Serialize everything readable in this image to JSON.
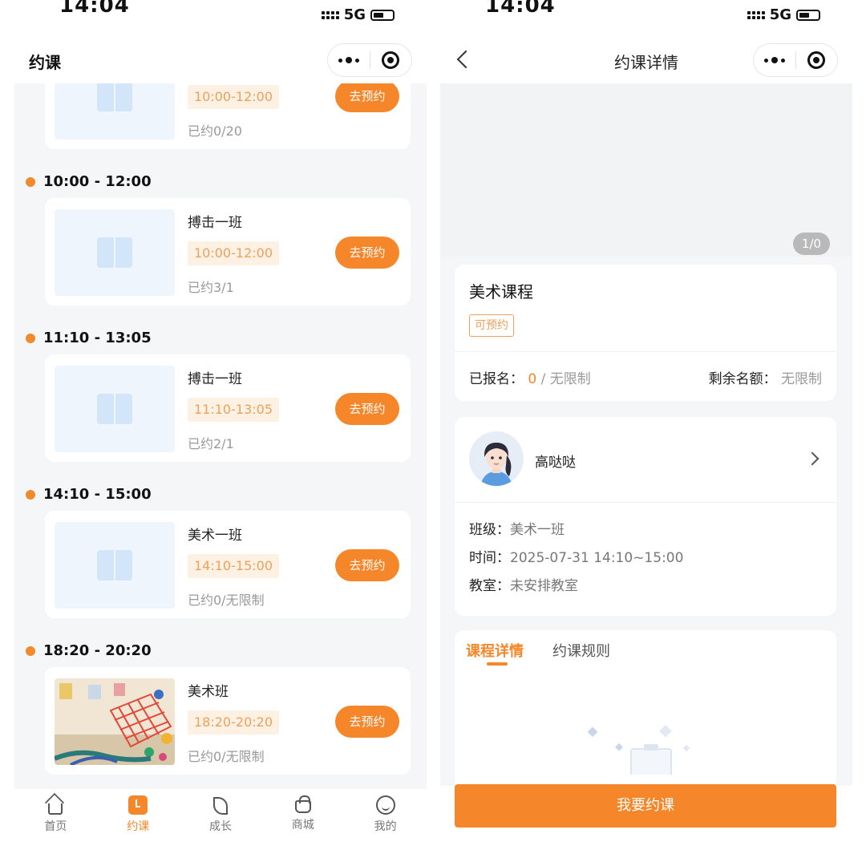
{
  "left": {
    "status": {
      "time": "14:04",
      "network": "5G"
    },
    "nav": {
      "title": "约课"
    },
    "top_card": {
      "time_tag": "10:00-12:00",
      "booked": "已约0/20",
      "button": "去预约"
    },
    "slots": [
      {
        "time": "10:00 - 12:00",
        "course": "搏击一班",
        "time_tag": "10:00-12:00",
        "booked": "已约3/1",
        "button": "去预约"
      },
      {
        "time": "11:10 - 13:05",
        "course": "搏击一班",
        "time_tag": "11:10-13:05",
        "booked": "已约2/1",
        "button": "去预约"
      },
      {
        "time": "14:10 - 15:00",
        "course": "美术一班",
        "time_tag": "14:10-15:00",
        "booked": "已约0/无限制",
        "button": "去预约"
      },
      {
        "time": "18:20 - 20:20",
        "course": "美术班",
        "time_tag": "18:20-20:20",
        "booked": "已约0/无限制",
        "button": "去预约"
      }
    ],
    "tabbar": [
      {
        "label": "首页",
        "icon": "home-icon",
        "active": false
      },
      {
        "label": "约课",
        "icon": "booking-icon",
        "active": true
      },
      {
        "label": "成长",
        "icon": "leaf-icon",
        "active": false
      },
      {
        "label": "商城",
        "icon": "shop-bag-icon",
        "active": false
      },
      {
        "label": "我的",
        "icon": "profile-icon",
        "active": false
      }
    ],
    "colors": {
      "accent": "#f5862a",
      "tag_bg": "#fdf1e4",
      "tag_text": "#f0a05a",
      "page_bg": "#f5f6f8"
    }
  },
  "right": {
    "status": {
      "time": "14:04",
      "network": "5G"
    },
    "nav": {
      "title": "约课详情"
    },
    "banner": {
      "pager": "1/0"
    },
    "course": {
      "title": "美术课程",
      "status_tag": "可预约",
      "signup_label": "已报名：",
      "signup_value": "0",
      "signup_limit": "/ 无限制",
      "remain_label": "剩余名额：",
      "remain_value": "无限制"
    },
    "teacher": {
      "name": "高哒哒"
    },
    "info": {
      "class_label": "班级：",
      "class_value": "美术一班",
      "time_label": "时间：",
      "time_value": "2025-07-31 14:10~15:00",
      "room_label": "教室：",
      "room_value": "未安排教室"
    },
    "tabs": {
      "detail": "课程详情",
      "rules": "约课规则"
    },
    "cta": "我要约课"
  }
}
